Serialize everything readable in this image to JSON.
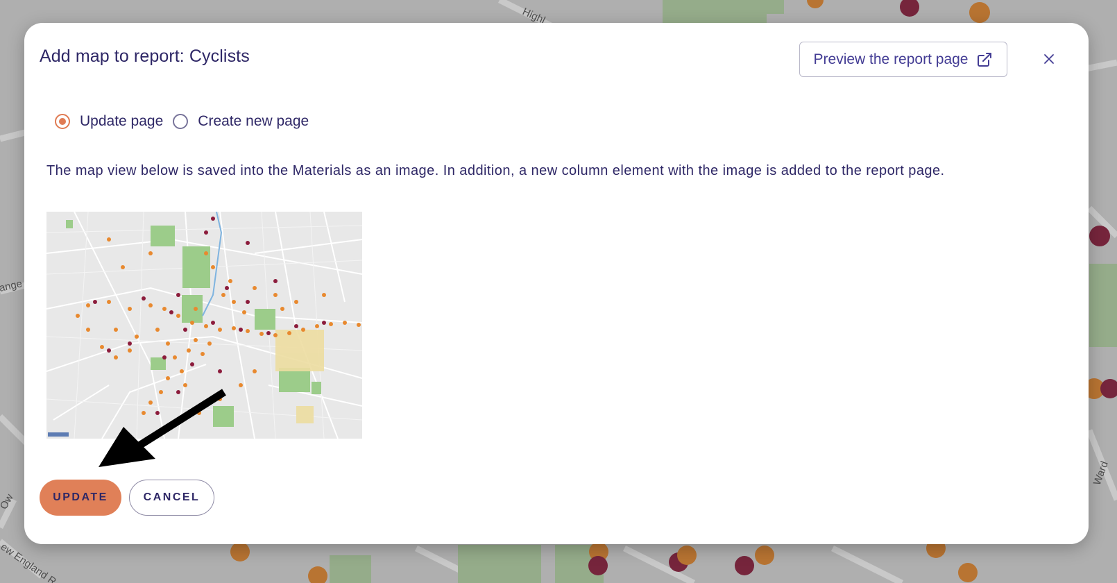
{
  "dialog": {
    "title": "Add map to report: Cyclists",
    "preview_label": "Preview the report page",
    "options": [
      {
        "label": "Update page",
        "selected": true
      },
      {
        "label": "Create new page",
        "selected": false
      }
    ],
    "description": "The map view below is saved into the Materials as an image. In addition, a new column element with the image is added to the report page.",
    "update_label": "UPDATE",
    "cancel_label": "CANCEL"
  },
  "background_map": {
    "street_labels": [
      "Highl",
      "ange",
      "Ward",
      "Ow",
      "ew England R"
    ]
  },
  "icons": {
    "preview": "external-link-icon",
    "close": "close-icon",
    "bike": "bicycle-icon",
    "annotation": "arrow-annotation"
  },
  "colors": {
    "accent": "#e07b53",
    "text": "#2e2766",
    "link": "#433c94",
    "marker_orange": "#e8892f",
    "marker_red": "#8c1c3c",
    "park_green": "#9ccc8a"
  }
}
